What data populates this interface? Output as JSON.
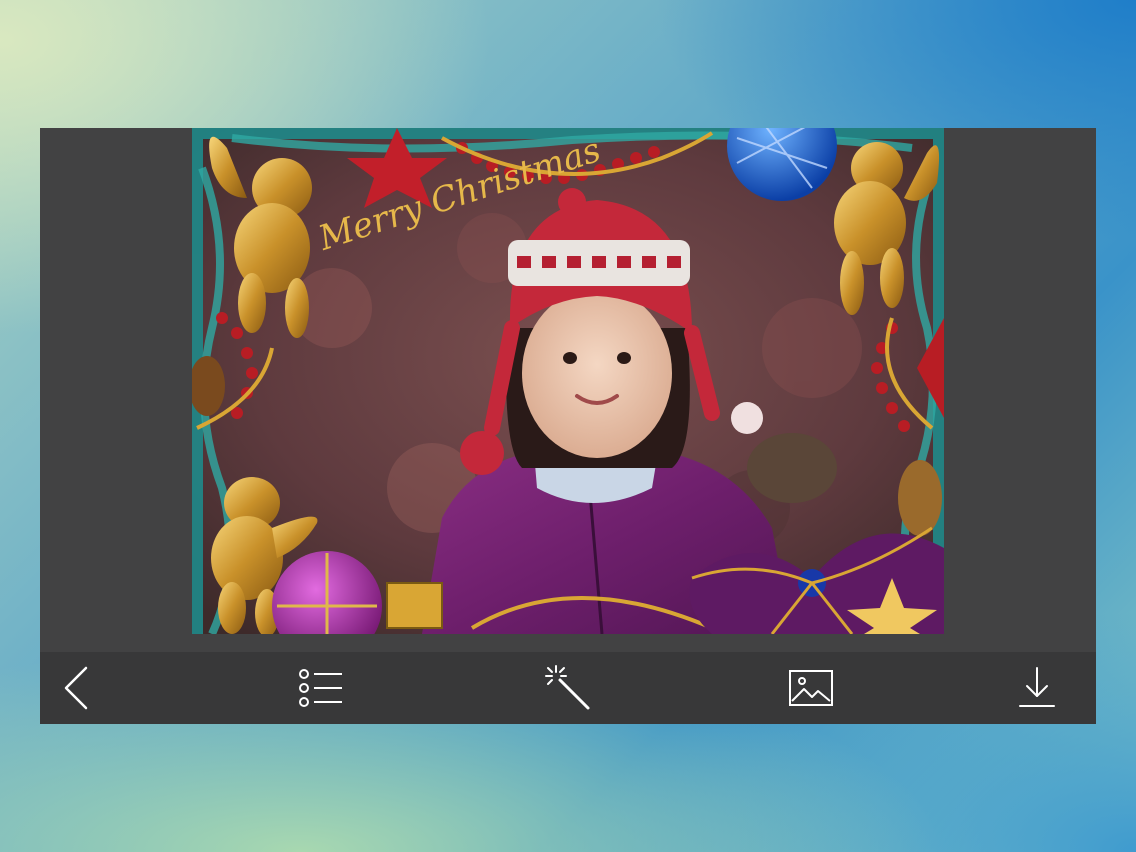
{
  "photo": {
    "frame_text": "Merry Christmas"
  },
  "toolbar": {
    "items": [
      {
        "icon": "chevron-left-icon",
        "action": "back"
      },
      {
        "icon": "list-icon",
        "action": "frames"
      },
      {
        "icon": "magic-wand-icon",
        "action": "effects"
      },
      {
        "icon": "image-icon",
        "action": "gallery"
      },
      {
        "icon": "download-icon",
        "action": "save"
      }
    ]
  },
  "colors": {
    "panel": "#3f3f40",
    "toolbar": "#383839",
    "icon": "#ffffff"
  }
}
